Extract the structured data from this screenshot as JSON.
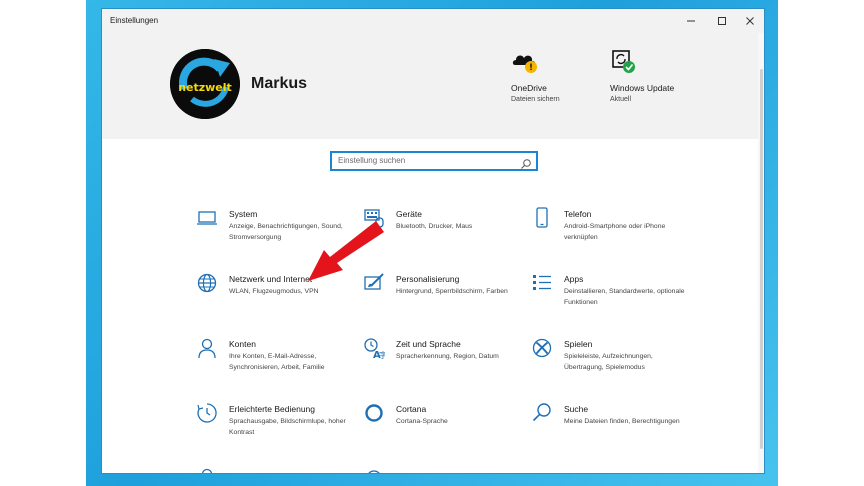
{
  "window": {
    "title": "Einstellungen",
    "controls": [
      "minimize-icon",
      "maximize-icon",
      "close-icon"
    ]
  },
  "profile": {
    "name": "Markus",
    "avatar_text": "netzwelt"
  },
  "quick_links": [
    {
      "title": "OneDrive",
      "subtitle": "Dateien sichern",
      "icon": "onedrive-warning-icon"
    },
    {
      "title": "Windows Update",
      "subtitle": "Aktuell",
      "icon": "windows-update-ok-icon"
    }
  ],
  "search": {
    "placeholder": "Einstellung suchen"
  },
  "categories": [
    {
      "title": "System",
      "desc": "Anzeige, Benachrichtigungen, Sound, Stromversorgung",
      "icon": "laptop-icon"
    },
    {
      "title": "Geräte",
      "desc": "Bluetooth, Drucker, Maus",
      "icon": "keyboard-icon"
    },
    {
      "title": "Telefon",
      "desc": "Android-Smartphone oder iPhone verknüpfen",
      "icon": "phone-icon"
    },
    {
      "title": "Netzwerk und Internet",
      "desc": "WLAN, Flugzeugmodus, VPN",
      "icon": "globe-icon"
    },
    {
      "title": "Personalisierung",
      "desc": "Hintergrund, Sperrbildschirm, Farben",
      "icon": "paint-icon"
    },
    {
      "title": "Apps",
      "desc": "Deinstallieren, Standardwerte, optionale Funktionen",
      "icon": "apps-list-icon"
    },
    {
      "title": "Konten",
      "desc": "Ihre Konten, E-Mail-Adresse, Synchronisieren, Arbeit, Familie",
      "icon": "person-icon"
    },
    {
      "title": "Zeit und Sprache",
      "desc": "Spracherkennung, Region, Datum",
      "icon": "time-language-icon"
    },
    {
      "title": "Spielen",
      "desc": "Spieleleiste, Aufzeichnungen, Übertragung, Spielemodus",
      "icon": "xbox-icon"
    },
    {
      "title": "Erleichterte Bedienung",
      "desc": "Sprachausgabe, Bildschirmlupe, hoher Kontrast",
      "icon": "ease-of-access-icon"
    },
    {
      "title": "Cortana",
      "desc": "Cortana-Sprache",
      "icon": "cortana-icon"
    },
    {
      "title": "Suche",
      "desc": "Meine Dateien finden, Berechtigungen",
      "icon": "search-icon"
    }
  ],
  "colors": {
    "accent": "#1a86d1",
    "icon_blue": "#1f6fb5",
    "annotation_arrow": "#e3141c"
  }
}
